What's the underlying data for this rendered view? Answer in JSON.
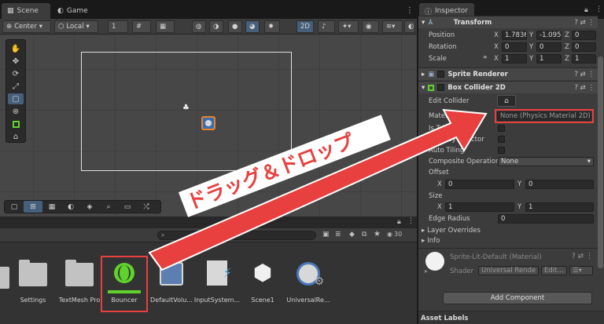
{
  "tabs": {
    "scene": "Scene",
    "game": "Game"
  },
  "scene_toolbar": {
    "pivot": "Center",
    "space": "Local",
    "snap_value": "1",
    "mode_2d": "2D"
  },
  "project": {
    "search_placeholder": "",
    "hidden_count": "30",
    "assets": [
      {
        "label": "Settings"
      },
      {
        "label": "TextMesh Pro"
      },
      {
        "label": "Bouncer"
      },
      {
        "label": "DefaultVolu..."
      },
      {
        "label": "InputSystem..."
      },
      {
        "label": "Scene1"
      },
      {
        "label": "UniversalRe..."
      }
    ]
  },
  "inspector": {
    "tab": "Inspector",
    "transform": {
      "title": "Transform",
      "position_label": "Position",
      "position": {
        "x": "1.7836",
        "y": "-1.095",
        "z": "0"
      },
      "rotation_label": "Rotation",
      "rotation": {
        "x": "0",
        "y": "0",
        "z": "0"
      },
      "scale_label": "Scale",
      "scale": {
        "x": "1",
        "y": "1",
        "z": "1"
      },
      "axis_x": "X",
      "axis_y": "Y",
      "axis_z": "Z"
    },
    "sprite_renderer": {
      "title": "Sprite Renderer"
    },
    "box_collider": {
      "title": "Box Collider 2D",
      "edit_collider": "Edit Collider",
      "material_label": "Material",
      "material_value": "None (Physics Material 2D)",
      "is_trigger": "Is Trigger",
      "used_by_effector": "Used By Effector",
      "auto_tiling": "Auto Tiling",
      "composite_operation": "Composite Operation",
      "composite_value": "None",
      "offset": "Offset",
      "offset_x": "0",
      "offset_y": "0",
      "size": "Size",
      "size_x": "1",
      "size_y": "1",
      "edge_radius": "Edge Radius",
      "edge_radius_value": "0",
      "layer_overrides": "Layer Overrides",
      "info": "Info"
    },
    "material": {
      "title": "Sprite-Lit-Default (Material)",
      "shader_label": "Shader",
      "shader_value": "Universal Rende",
      "edit": "Edit..."
    },
    "add_component": "Add Component",
    "asset_labels": "Asset Labels"
  },
  "annotation": {
    "text": "ドラッグ＆ドロップ",
    "color": "#e8403f"
  },
  "colors": {
    "selection": "#e8403f",
    "accent_green": "#5fd32b",
    "selected_tool": "#46607c"
  }
}
